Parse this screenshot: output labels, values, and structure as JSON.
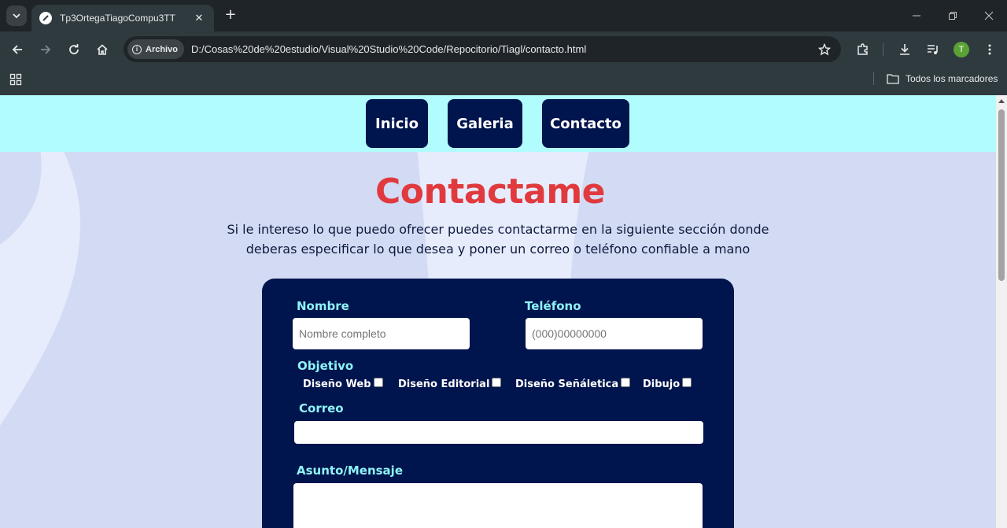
{
  "browser": {
    "tab_title": "Tp3OrtegaTiagoCompu3TT",
    "site_chip": "Archivo",
    "url": "D:/Cosas%20de%20estudio/Visual%20Studio%20Code/Repocitorio/Tiagl/contacto.html",
    "profile_initial": "T",
    "bookmarks_all": "Todos los marcadores"
  },
  "nav": {
    "items": [
      "Inicio",
      "Galeria",
      "Contacto"
    ]
  },
  "page": {
    "title": "Contactame",
    "intro": "Si le intereso lo que puedo ofrecer puedes contactarme en la siguiente sección donde deberas especificar lo que desea y poner un correo o teléfono confiable a mano"
  },
  "form": {
    "name_label": "Nombre",
    "name_placeholder": "Nombre completo",
    "phone_label": "Teléfono",
    "phone_placeholder": "(000)00000000",
    "objective_label": "Objetivo",
    "objectives": [
      "Diseño Web",
      "Diseño Editorial",
      "Diseño Señáletica",
      "Dibujo"
    ],
    "email_label": "Correo",
    "message_label": "Asunto/Mensaje"
  },
  "colors": {
    "navbar_bg": "#b1fcfd",
    "button_bg": "#00144d",
    "title": "#e03a3e",
    "label": "#8ef3f7",
    "page_bg": "#d2dbf3"
  }
}
